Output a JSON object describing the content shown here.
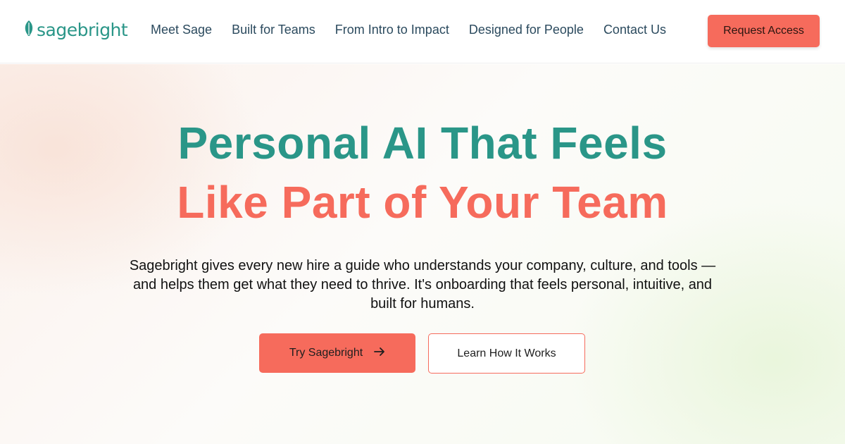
{
  "brand": {
    "name": "sagebright",
    "logo_icon": "leaf-icon",
    "primary_color": "#2a9688",
    "accent_color": "#f66b5c"
  },
  "nav": {
    "links": [
      "Meet Sage",
      "Built for Teams",
      "From Intro to Impact",
      "Designed for People",
      "Contact Us"
    ],
    "cta_label": "Request Access"
  },
  "hero": {
    "headline_line1": "Personal AI That Feels",
    "headline_line2": "Like Part of Your Team",
    "subtext": "Sagebright gives every new hire a guide who understands your company, culture, and tools — and helps them get what they need to thrive. It's onboarding that feels personal, intuitive, and built for humans.",
    "primary_button": "Try Sagebright",
    "primary_button_icon": "arrow-right-icon",
    "secondary_button": "Learn How It Works"
  }
}
